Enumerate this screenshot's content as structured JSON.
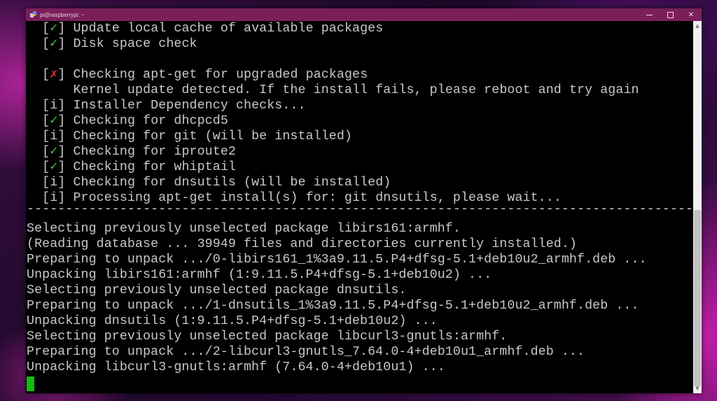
{
  "window": {
    "title": "pi@raspberrypi: ~",
    "controls": {
      "minimize": "minimize",
      "maximize": "maximize",
      "close": "✕"
    }
  },
  "terminal": {
    "status_lines": [
      {
        "marker": "✓",
        "status": "ok",
        "text": "Update local cache of available packages"
      },
      {
        "marker": "✓",
        "status": "ok",
        "text": "Disk space check"
      },
      {
        "marker": "",
        "status": "blank",
        "text": ""
      },
      {
        "marker": "✗",
        "status": "fail",
        "text": "Checking apt-get for upgraded packages"
      },
      {
        "marker": "",
        "status": "continuation",
        "text": "Kernel update detected. If the install fails, please reboot and try again"
      },
      {
        "marker": "i",
        "status": "info",
        "text": "Installer Dependency checks..."
      },
      {
        "marker": "✓",
        "status": "ok",
        "text": "Checking for dhcpcd5"
      },
      {
        "marker": "i",
        "status": "info",
        "text": "Checking for git (will be installed)"
      },
      {
        "marker": "✓",
        "status": "ok",
        "text": "Checking for iproute2"
      },
      {
        "marker": "✓",
        "status": "ok",
        "text": "Checking for whiptail"
      },
      {
        "marker": "i",
        "status": "info",
        "text": "Checking for dnsutils (will be installed)"
      },
      {
        "marker": "i",
        "status": "info",
        "text": "Processing apt-get install(s) for: git dnsutils, please wait..."
      }
    ],
    "separator": "---------------------------------------------------------------------------------------",
    "output_lines": [
      "Selecting previously unselected package libirs161:armhf.",
      "(Reading database ... 39949 files and directories currently installed.)",
      "Preparing to unpack .../0-libirs161_1%3a9.11.5.P4+dfsg-5.1+deb10u2_armhf.deb ...",
      "Unpacking libirs161:armhf (1:9.11.5.P4+dfsg-5.1+deb10u2) ...",
      "Selecting previously unselected package dnsutils.",
      "Preparing to unpack .../1-dnsutils_1%3a9.11.5.P4+dfsg-5.1+deb10u2_armhf.deb ...",
      "Unpacking dnsutils (1:9.11.5.P4+dfsg-5.1+deb10u2) ...",
      "Selecting previously unselected package libcurl3-gnutls:armhf.",
      "Preparing to unpack .../2-libcurl3-gnutls_7.64.0-4+deb10u1_armhf.deb ...",
      "Unpacking libcurl3-gnutls:armhf (7.64.0-4+deb10u1) ..."
    ],
    "colors": {
      "ok": "#3fc43f",
      "fail": "#e03030",
      "text": "#c8c8c8",
      "cursor": "#0cbf0c",
      "titlebar": "#7a1f5a"
    }
  },
  "scrollbar": {
    "up_arrow": "▲",
    "down_arrow": "▼",
    "position_fraction": 0.5
  }
}
